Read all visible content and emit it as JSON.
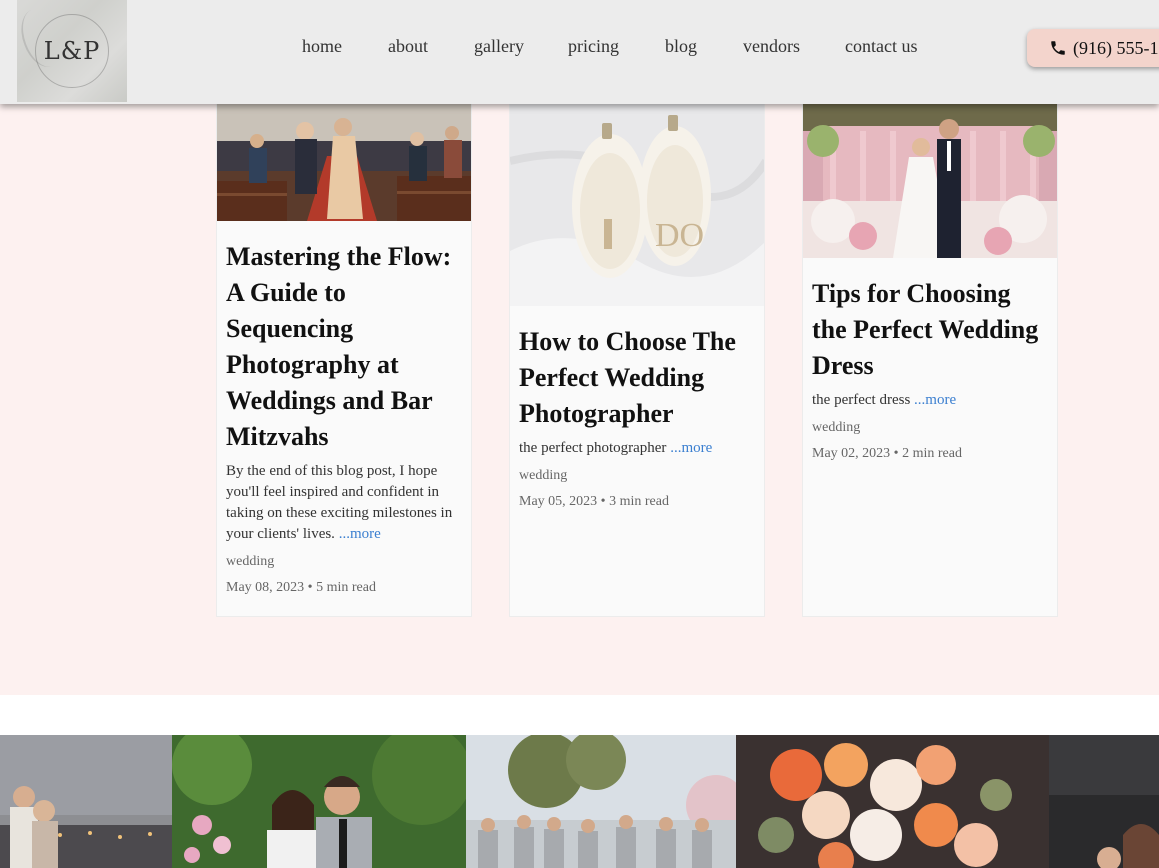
{
  "header": {
    "logo_text": "L&P",
    "nav": [
      {
        "label": "home"
      },
      {
        "label": "about"
      },
      {
        "label": "gallery"
      },
      {
        "label": "pricing"
      },
      {
        "label": "blog"
      },
      {
        "label": "vendors"
      },
      {
        "label": "contact us"
      }
    ],
    "phone": "(916) 555-1"
  },
  "posts": [
    {
      "title": "Mastering the Flow: A Guide to Sequencing Photography at Weddings and Bar Mitzvahs",
      "excerpt": "By the end of this blog post, I hope you'll feel inspired and confident in taking on these exciting milestones in your clients' lives.",
      "more": "...more",
      "tag": "wedding",
      "date": "May 08, 2023",
      "read_time": "5 min read"
    },
    {
      "title": "How to Choose The Perfect Wedding Photographer",
      "excerpt": "the perfect photographer",
      "more": "...more",
      "tag": "wedding",
      "date": "May 05, 2023",
      "read_time": "3 min read"
    },
    {
      "title": "Tips for Choosing the Perfect Wedding Dress",
      "excerpt": "the perfect dress",
      "more": "...more",
      "tag": "wedding",
      "date": "May 02, 2023",
      "read_time": "2 min read"
    }
  ],
  "colors": {
    "background": "#fdf1f0",
    "header": "#ececec",
    "phone_button": "#f3d4cc",
    "link": "#3b7fd0"
  },
  "icons": {
    "phone": "phone-icon"
  }
}
